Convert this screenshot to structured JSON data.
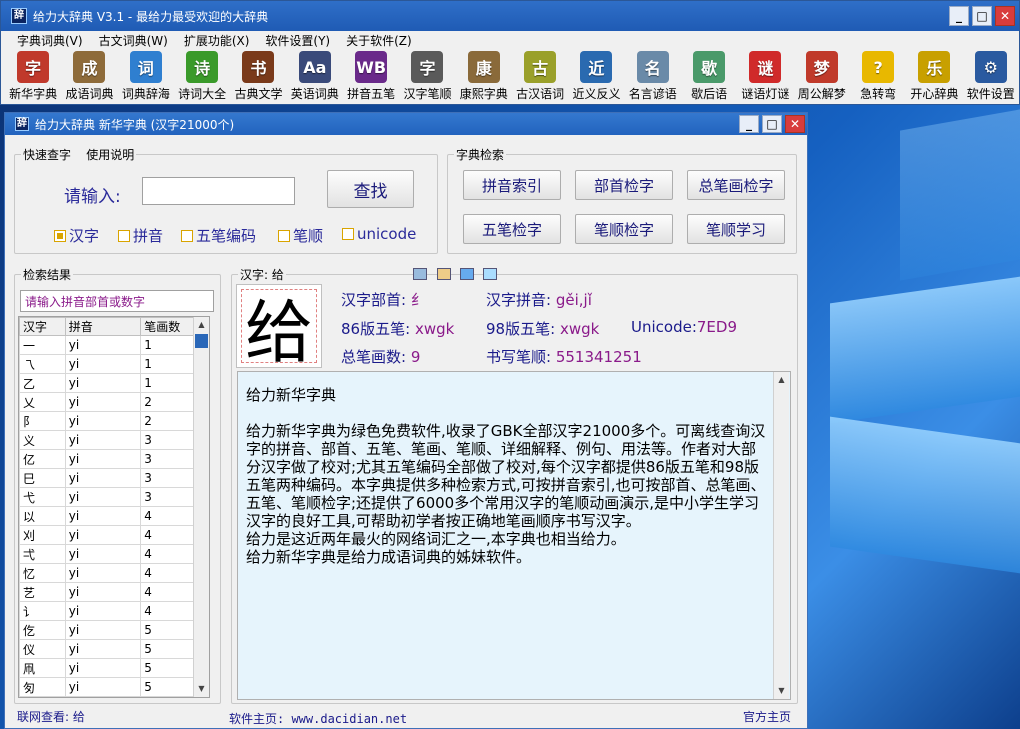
{
  "app": {
    "title": "给力大辞典 V3.1 - 最给力最受欢迎的大辞典",
    "menu": [
      "字典词典(V)",
      "古文词典(W)",
      "扩展功能(X)",
      "软件设置(Y)",
      "关于软件(Z)"
    ],
    "toolbar": [
      {
        "label": "新华字典",
        "icon": "xinhua-dict-icon",
        "color": "#c0392b",
        "glyph": "字"
      },
      {
        "label": "成语词典",
        "icon": "idiom-dict-icon",
        "color": "#8e6b3a",
        "glyph": "成"
      },
      {
        "label": "词典辞海",
        "icon": "cihai-icon",
        "color": "#2f7fd0",
        "glyph": "词"
      },
      {
        "label": "诗词大全",
        "icon": "poetry-icon",
        "color": "#3a9a2a",
        "glyph": "诗"
      },
      {
        "label": "古典文学",
        "icon": "classic-books-icon",
        "color": "#7a3a1a",
        "glyph": "书"
      },
      {
        "label": "英语词典",
        "icon": "english-dict-icon",
        "color": "#3a4a7a",
        "glyph": "Aa"
      },
      {
        "label": "拼音五笔",
        "icon": "pinyin-wubi-icon",
        "color": "#6a2a8a",
        "glyph": "WB"
      },
      {
        "label": "汉字笔顺",
        "icon": "stroke-order-icon",
        "color": "#5a5a5a",
        "glyph": "字"
      },
      {
        "label": "康熙字典",
        "icon": "kangxi-icon",
        "color": "#8a6a3a",
        "glyph": "康"
      },
      {
        "label": "古汉语词",
        "icon": "ancient-chinese-icon",
        "color": "#9aa02a",
        "glyph": "古"
      },
      {
        "label": "近义反义",
        "icon": "synonym-icon",
        "color": "#2a6ab0",
        "glyph": "近"
      },
      {
        "label": "名言谚语",
        "icon": "proverb-icon",
        "color": "#6a8aa8",
        "glyph": "名"
      },
      {
        "label": "歇后语",
        "icon": "xiehouyu-icon",
        "color": "#4a9a6a",
        "glyph": "歇"
      },
      {
        "label": "谜语灯谜",
        "icon": "riddle-lantern-icon",
        "color": "#d02a2a",
        "glyph": "谜"
      },
      {
        "label": "周公解梦",
        "icon": "dream-icon",
        "color": "#c03a2a",
        "glyph": "梦"
      },
      {
        "label": "急转弯",
        "icon": "bulb-icon",
        "color": "#e8b800",
        "glyph": "?"
      },
      {
        "label": "开心辞典",
        "icon": "happy-dict-icon",
        "color": "#c8a000",
        "glyph": "乐"
      },
      {
        "label": "软件设置",
        "icon": "settings-icon",
        "color": "#2a5aa0",
        "glyph": "⚙"
      }
    ]
  },
  "child": {
    "title": "给力大辞典  新华字典  (汉字21000个)",
    "quick": {
      "label1": "快速查字",
      "label2": "使用说明",
      "prompt": "请输入:",
      "input_value": "",
      "search_btn": "查找",
      "options": [
        {
          "label": "汉字",
          "checked": true
        },
        {
          "label": "拼音",
          "checked": false
        },
        {
          "label": "五笔编码",
          "checked": false
        },
        {
          "label": "笔顺",
          "checked": false
        },
        {
          "label": "unicode",
          "checked": false
        }
      ]
    },
    "index": {
      "label": "字典检索",
      "buttons": [
        "拼音索引",
        "部首检字",
        "总笔画检字",
        "五笔检字",
        "笔顺检字",
        "笔顺学习"
      ]
    },
    "results": {
      "label": "检索结果",
      "placeholder": "请输入拼音部首或数字",
      "headers": [
        "汉字",
        "拼音",
        "笔画数"
      ],
      "rows": [
        [
          "一",
          "yi",
          "1"
        ],
        [
          "乁",
          "yi",
          "1"
        ],
        [
          "乙",
          "yi",
          "1"
        ],
        [
          "乂",
          "yi",
          "2"
        ],
        [
          "阝",
          "yi",
          "2"
        ],
        [
          "义",
          "yi",
          "3"
        ],
        [
          "亿",
          "yi",
          "3"
        ],
        [
          "巳",
          "yi",
          "3"
        ],
        [
          "弋",
          "yi",
          "3"
        ],
        [
          "以",
          "yi",
          "4"
        ],
        [
          "刈",
          "yi",
          "4"
        ],
        [
          "弌",
          "yi",
          "4"
        ],
        [
          "忆",
          "yi",
          "4"
        ],
        [
          "艺",
          "yi",
          "4"
        ],
        [
          "讠",
          "yi",
          "4"
        ],
        [
          "仡",
          "yi",
          "5"
        ],
        [
          "仪",
          "yi",
          "5"
        ],
        [
          "凧",
          "yi",
          "5"
        ],
        [
          "匇",
          "yi",
          "5"
        ]
      ]
    },
    "detail": {
      "label": "汉字: 给",
      "char": "给",
      "radical_label": "汉字部首:",
      "radical": "纟",
      "pinyin_label": "汉字拼音:",
      "pinyin": "gěi,jǐ",
      "wubi86_label": "86版五笔:",
      "wubi86": "xwgk",
      "wubi98_label": "98版五笔:",
      "wubi98": "xwgk",
      "unicode_label": "Unicode:",
      "unicode": "7ED9",
      "strokes_label": "总笔画数:",
      "strokes": "9",
      "order_label": "书写笔顺:",
      "order": "551341251",
      "text": [
        "给力新华字典",
        "",
        "给力新华字典为绿色免费软件,收录了GBK全部汉字21000多个。可离线查询汉字的拼音、部首、五笔、笔画、笔顺、详细解释、例句、用法等。作者对大部分汉字做了校对;尤其五笔编码全部做了校对,每个汉字都提供86版五笔和98版五笔两种编码。本字典提供多种检索方式,可按拼音索引,也可按部首、总笔画、五笔、笔顺检字;还提供了6000多个常用汉字的笔顺动画演示,是中小学生学习汉字的良好工具,可帮助初学者按正确地笔画顺序书写汉字。",
        "给力是这近两年最火的网络词汇之一,本字典也相当给力。",
        "给力新华字典是给力成语词典的姊妹软件。"
      ]
    },
    "status": {
      "left": "联网查看: 给",
      "center": "软件主页: www.dacidian.net",
      "right": "官方主页"
    }
  }
}
